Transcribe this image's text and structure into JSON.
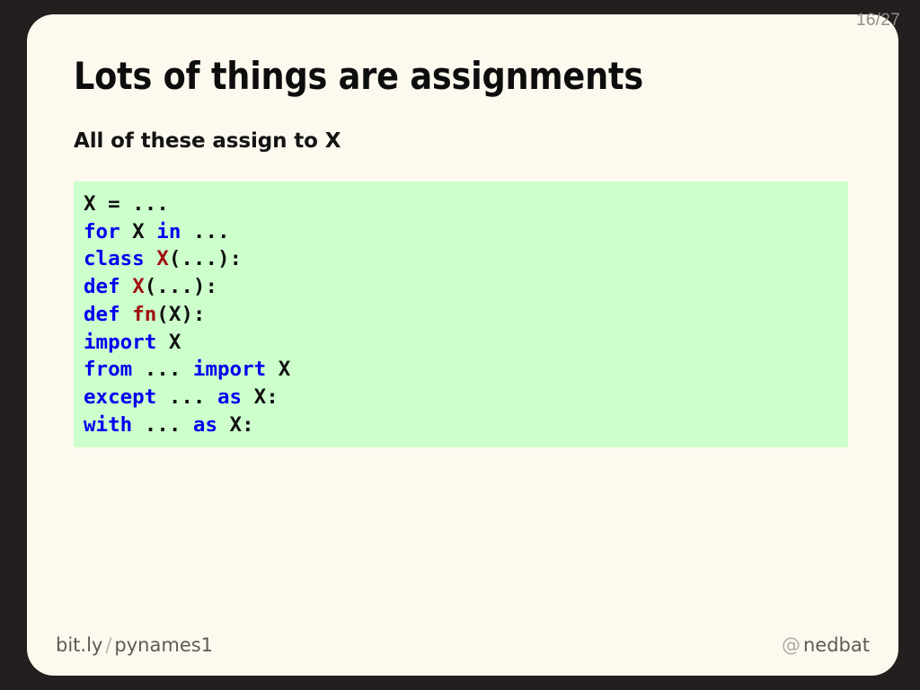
{
  "deck": {
    "page_indicator": "16/27",
    "backdrop_color": "#221f1e",
    "slide_color": "#fdf9ef"
  },
  "slide": {
    "title": "Lots of things are assignments",
    "subtitle": "All of these assign to X"
  },
  "code_block": {
    "background_color": "#ccffcc",
    "keyword_color": "#0000ee",
    "name_color": "#a01010",
    "text_color": "#111111",
    "lines": [
      {
        "plain": "X = ...",
        "tokens": [
          {
            "text": "X = ...",
            "kind": "txt"
          }
        ]
      },
      {
        "plain": "for X in ...",
        "tokens": [
          {
            "text": "for",
            "kind": "kw"
          },
          {
            "text": " X ",
            "kind": "txt"
          },
          {
            "text": "in",
            "kind": "kw"
          },
          {
            "text": " ...",
            "kind": "txt"
          }
        ]
      },
      {
        "plain": "class X(...):",
        "tokens": [
          {
            "text": "class",
            "kind": "kw"
          },
          {
            "text": " ",
            "kind": "txt"
          },
          {
            "text": "X",
            "kind": "name"
          },
          {
            "text": "(...):",
            "kind": "txt"
          }
        ]
      },
      {
        "plain": "def X(...):",
        "tokens": [
          {
            "text": "def",
            "kind": "kw"
          },
          {
            "text": " ",
            "kind": "txt"
          },
          {
            "text": "X",
            "kind": "name"
          },
          {
            "text": "(...):",
            "kind": "txt"
          }
        ]
      },
      {
        "plain": "def fn(X):",
        "tokens": [
          {
            "text": "def",
            "kind": "kw"
          },
          {
            "text": " ",
            "kind": "txt"
          },
          {
            "text": "fn",
            "kind": "name"
          },
          {
            "text": "(X):",
            "kind": "txt"
          }
        ]
      },
      {
        "plain": "import X",
        "tokens": [
          {
            "text": "import",
            "kind": "kw"
          },
          {
            "text": " X",
            "kind": "txt"
          }
        ]
      },
      {
        "plain": "from ... import X",
        "tokens": [
          {
            "text": "from",
            "kind": "kw"
          },
          {
            "text": " ... ",
            "kind": "txt"
          },
          {
            "text": "import",
            "kind": "kw"
          },
          {
            "text": " X",
            "kind": "txt"
          }
        ]
      },
      {
        "plain": "except ... as X:",
        "tokens": [
          {
            "text": "except",
            "kind": "kw"
          },
          {
            "text": " ... ",
            "kind": "txt"
          },
          {
            "text": "as",
            "kind": "kw"
          },
          {
            "text": " X:",
            "kind": "txt"
          }
        ]
      },
      {
        "plain": "with ... as X:",
        "tokens": [
          {
            "text": "with",
            "kind": "kw"
          },
          {
            "text": " ... ",
            "kind": "txt"
          },
          {
            "text": "as",
            "kind": "kw"
          },
          {
            "text": " X:",
            "kind": "txt"
          }
        ]
      }
    ]
  },
  "footer": {
    "left_domain": "bit.ly",
    "left_separator": "/",
    "left_path": "pynames1",
    "right_at": "@",
    "right_handle": "nedbat"
  }
}
